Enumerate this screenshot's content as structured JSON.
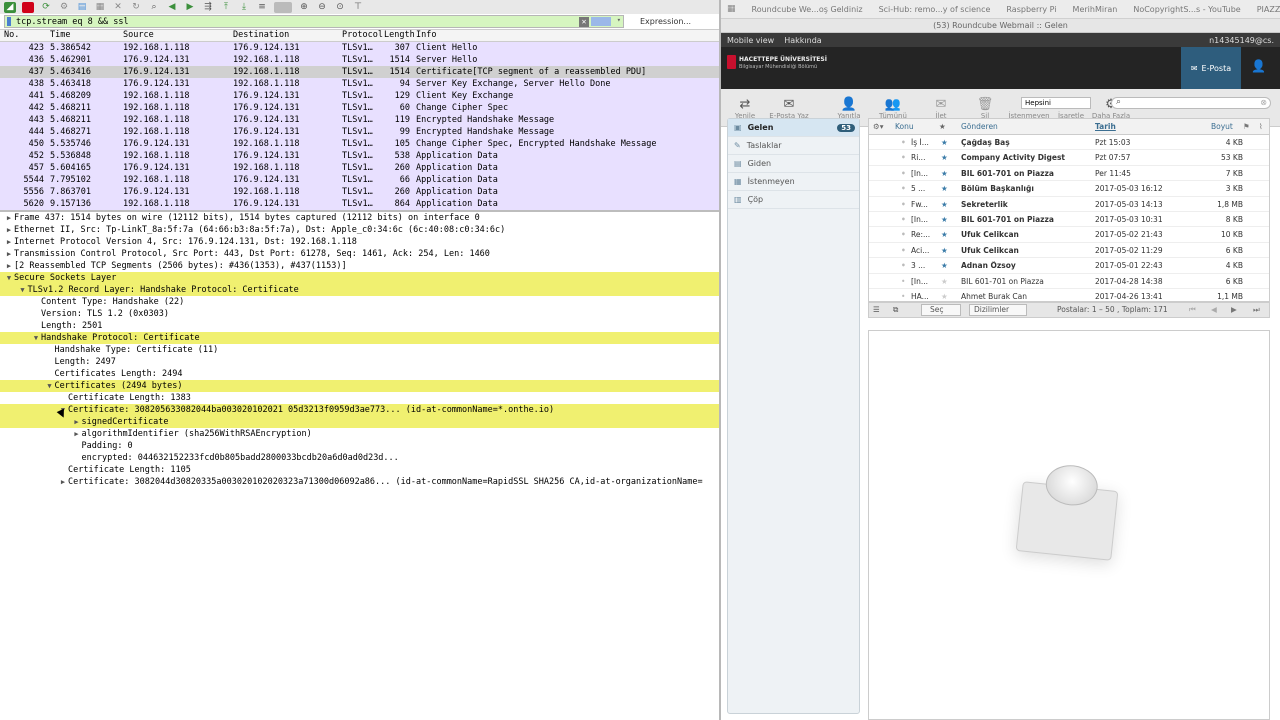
{
  "wireshark": {
    "filter": "tcp.stream eq 8 && ssl",
    "expression_label": "Expression...",
    "plus_label": "+",
    "columns": [
      "No.",
      "Time",
      "Source",
      "Destination",
      "Protocol",
      "Length",
      "Info"
    ],
    "packets": [
      {
        "no": "423",
        "time": "5.386542",
        "src": "192.168.1.118",
        "dst": "176.9.124.131",
        "proto": "TLSv1…",
        "len": "307",
        "info": "Client Hello"
      },
      {
        "no": "436",
        "time": "5.462901",
        "src": "176.9.124.131",
        "dst": "192.168.1.118",
        "proto": "TLSv1…",
        "len": "1514",
        "info": "Server Hello"
      },
      {
        "no": "437",
        "time": "5.463416",
        "src": "176.9.124.131",
        "dst": "192.168.1.118",
        "proto": "TLSv1…",
        "len": "1514",
        "info": "Certificate[TCP segment of a reassembled PDU]"
      },
      {
        "no": "438",
        "time": "5.463418",
        "src": "176.9.124.131",
        "dst": "192.168.1.118",
        "proto": "TLSv1…",
        "len": "94",
        "info": "Server Key Exchange, Server Hello Done"
      },
      {
        "no": "441",
        "time": "5.468209",
        "src": "192.168.1.118",
        "dst": "176.9.124.131",
        "proto": "TLSv1…",
        "len": "129",
        "info": "Client Key Exchange"
      },
      {
        "no": "442",
        "time": "5.468211",
        "src": "192.168.1.118",
        "dst": "176.9.124.131",
        "proto": "TLSv1…",
        "len": "60",
        "info": "Change Cipher Spec"
      },
      {
        "no": "443",
        "time": "5.468211",
        "src": "192.168.1.118",
        "dst": "176.9.124.131",
        "proto": "TLSv1…",
        "len": "119",
        "info": "Encrypted Handshake Message"
      },
      {
        "no": "444",
        "time": "5.468271",
        "src": "192.168.1.118",
        "dst": "176.9.124.131",
        "proto": "TLSv1…",
        "len": "99",
        "info": "Encrypted Handshake Message"
      },
      {
        "no": "450",
        "time": "5.535746",
        "src": "176.9.124.131",
        "dst": "192.168.1.118",
        "proto": "TLSv1…",
        "len": "105",
        "info": "Change Cipher Spec, Encrypted Handshake Message"
      },
      {
        "no": "452",
        "time": "5.536848",
        "src": "192.168.1.118",
        "dst": "176.9.124.131",
        "proto": "TLSv1…",
        "len": "538",
        "info": "Application Data"
      },
      {
        "no": "457",
        "time": "5.604165",
        "src": "176.9.124.131",
        "dst": "192.168.1.118",
        "proto": "TLSv1…",
        "len": "260",
        "info": "Application Data"
      },
      {
        "no": "5544",
        "time": "7.795102",
        "src": "192.168.1.118",
        "dst": "176.9.124.131",
        "proto": "TLSv1…",
        "len": "66",
        "info": "Application Data"
      },
      {
        "no": "5556",
        "time": "7.863701",
        "src": "176.9.124.131",
        "dst": "192.168.1.118",
        "proto": "TLSv1…",
        "len": "260",
        "info": "Application Data"
      },
      {
        "no": "5620",
        "time": "9.157136",
        "src": "192.168.1.118",
        "dst": "176.9.124.131",
        "proto": "TLSv1…",
        "len": "864",
        "info": "Application Data"
      }
    ],
    "details": [
      {
        "indent": 0,
        "arrow": "▶",
        "hl": false,
        "text": "Frame 437: 1514 bytes on wire (12112 bits), 1514 bytes captured (12112 bits) on interface 0"
      },
      {
        "indent": 0,
        "arrow": "▶",
        "hl": false,
        "text": "Ethernet II, Src: Tp-LinkT_8a:5f:7a (64:66:b3:8a:5f:7a), Dst: Apple_c0:34:6c (6c:40:08:c0:34:6c)"
      },
      {
        "indent": 0,
        "arrow": "▶",
        "hl": false,
        "text": "Internet Protocol Version 4, Src: 176.9.124.131, Dst: 192.168.1.118"
      },
      {
        "indent": 0,
        "arrow": "▶",
        "hl": false,
        "text": "Transmission Control Protocol, Src Port: 443, Dst Port: 61278, Seq: 1461, Ack: 254, Len: 1460"
      },
      {
        "indent": 0,
        "arrow": "▶",
        "hl": false,
        "text": "[2 Reassembled TCP Segments (2506 bytes): #436(1353), #437(1153)]"
      },
      {
        "indent": 0,
        "arrow": "▼",
        "hl": true,
        "text": "Secure Sockets Layer"
      },
      {
        "indent": 1,
        "arrow": "▼",
        "hl": true,
        "text": "TLSv1.2 Record Layer: Handshake Protocol: Certificate"
      },
      {
        "indent": 2,
        "arrow": "",
        "hl": false,
        "text": "Content Type: Handshake (22)"
      },
      {
        "indent": 2,
        "arrow": "",
        "hl": false,
        "text": "Version: TLS 1.2 (0x0303)"
      },
      {
        "indent": 2,
        "arrow": "",
        "hl": false,
        "text": "Length: 2501"
      },
      {
        "indent": 2,
        "arrow": "▼",
        "hl": true,
        "text": "Handshake Protocol: Certificate"
      },
      {
        "indent": 3,
        "arrow": "",
        "hl": false,
        "text": "Handshake Type: Certificate (11)"
      },
      {
        "indent": 3,
        "arrow": "",
        "hl": false,
        "text": "Length: 2497"
      },
      {
        "indent": 3,
        "arrow": "",
        "hl": false,
        "text": "Certificates Length: 2494"
      },
      {
        "indent": 3,
        "arrow": "▼",
        "hl": true,
        "text": "Certificates (2494 bytes)"
      },
      {
        "indent": 4,
        "arrow": "",
        "hl": false,
        "text": "Certificate Length: 1383"
      },
      {
        "indent": 4,
        "arrow": "▼",
        "hl": true,
        "text": "Certificate: 308205633082044ba003020102021 05d3213f0959d3ae773... (id-at-commonName=*.onthe.io)"
      },
      {
        "indent": 5,
        "arrow": "▶",
        "hl": true,
        "text": "signedCertificate"
      },
      {
        "indent": 5,
        "arrow": "▶",
        "hl": false,
        "text": "algorithmIdentifier (sha256WithRSAEncryption)"
      },
      {
        "indent": 5,
        "arrow": "",
        "hl": false,
        "text": "Padding: 0"
      },
      {
        "indent": 5,
        "arrow": "",
        "hl": false,
        "text": "encrypted: 044632152233fcd0b805badd2800033bcdb20a6d0ad0d23d..."
      },
      {
        "indent": 4,
        "arrow": "",
        "hl": false,
        "text": "Certificate Length: 1105"
      },
      {
        "indent": 4,
        "arrow": "▶",
        "hl": false,
        "text": "Certificate: 3082044d30820335a003020102020323a71300d06092a86... (id-at-commonName=RapidSSL SHA256 CA,id-at-organizationName="
      }
    ]
  },
  "browser": {
    "bookmarks": [
      "Roundcube We...oş Geldiniz",
      "Sci-Hub: remo...y of science",
      "Raspberry Pi",
      "MerihMiran",
      "NoCopyrightS...s - YouTube",
      "PIAZZA"
    ],
    "tab_title": "(53) Roundcube Webmail :: Gelen",
    "top_links": [
      "Mobile view",
      "Hakkında"
    ],
    "user": "n14345149@cs.",
    "logo_title": "HACETTEPE ÜNİVERSİTESİ",
    "logo_sub": "Bilgisayar Mühendisliği Bölümü",
    "eposta": "E-Posta",
    "toolbar": [
      "Yenile",
      "E-Posta Yaz",
      "Yanıtla",
      "Tümünü Ya...",
      "İlet",
      "Sil",
      "İstenmeyen",
      "İşaretle",
      "Daha Fazla"
    ],
    "search_filter": "Hepsini",
    "folders": [
      {
        "name": "Gelen",
        "count": "53",
        "icon": "inbox-icon"
      },
      {
        "name": "Taslaklar",
        "count": "",
        "icon": "pencil-icon"
      },
      {
        "name": "Giden",
        "count": "",
        "icon": "outbox-icon"
      },
      {
        "name": "İstenmeyen",
        "count": "",
        "icon": "junk-icon"
      },
      {
        "name": "Çöp",
        "count": "",
        "icon": "trash-icon"
      }
    ],
    "headers": [
      "Konu",
      "Gönderen",
      "Tarih",
      "Boyut"
    ],
    "messages": [
      {
        "subj": "İş İ...",
        "from": "Çağdaş Baş",
        "date": "Pzt 15:03",
        "size": "4 KB",
        "bold": true
      },
      {
        "subj": "Ri...",
        "from": "Company Activity Digest",
        "date": "Pzt 07:57",
        "size": "53 KB",
        "bold": true
      },
      {
        "subj": "[In...",
        "from": "BIL 601-701 on Piazza",
        "date": "Per 11:45",
        "size": "7 KB",
        "bold": true
      },
      {
        "subj": "5 ...",
        "from": "Bölüm Başkanlığı",
        "date": "2017-05-03 16:12",
        "size": "3 KB",
        "bold": true
      },
      {
        "subj": "Fw...",
        "from": "Sekreterlik",
        "date": "2017-05-03 14:13",
        "size": "1,8 MB",
        "bold": true
      },
      {
        "subj": "[In...",
        "from": "BIL 601-701 on Piazza",
        "date": "2017-05-03 10:31",
        "size": "8 KB",
        "bold": true
      },
      {
        "subj": "Re:...",
        "from": "Ufuk Celikcan",
        "date": "2017-05-02 21:43",
        "size": "10 KB",
        "bold": true
      },
      {
        "subj": "Aci...",
        "from": "Ufuk Celikcan",
        "date": "2017-05-02 11:29",
        "size": "6 KB",
        "bold": true
      },
      {
        "subj": "3 ...",
        "from": "Adnan Özsoy",
        "date": "2017-05-01 22:43",
        "size": "4 KB",
        "bold": true
      },
      {
        "subj": "[In...",
        "from": "BIL 601-701 on Piazza",
        "date": "2017-04-28 14:38",
        "size": "6 KB",
        "bold": false
      },
      {
        "subj": "HA...",
        "from": "Ahmet Burak Can",
        "date": "2017-04-26 13:41",
        "size": "1,1 MB",
        "bold": false
      }
    ],
    "select_label": "Seç",
    "thread_label": "Dizilimler",
    "count_text": "Postalar: 1 – 50 , Toplam: 171"
  }
}
